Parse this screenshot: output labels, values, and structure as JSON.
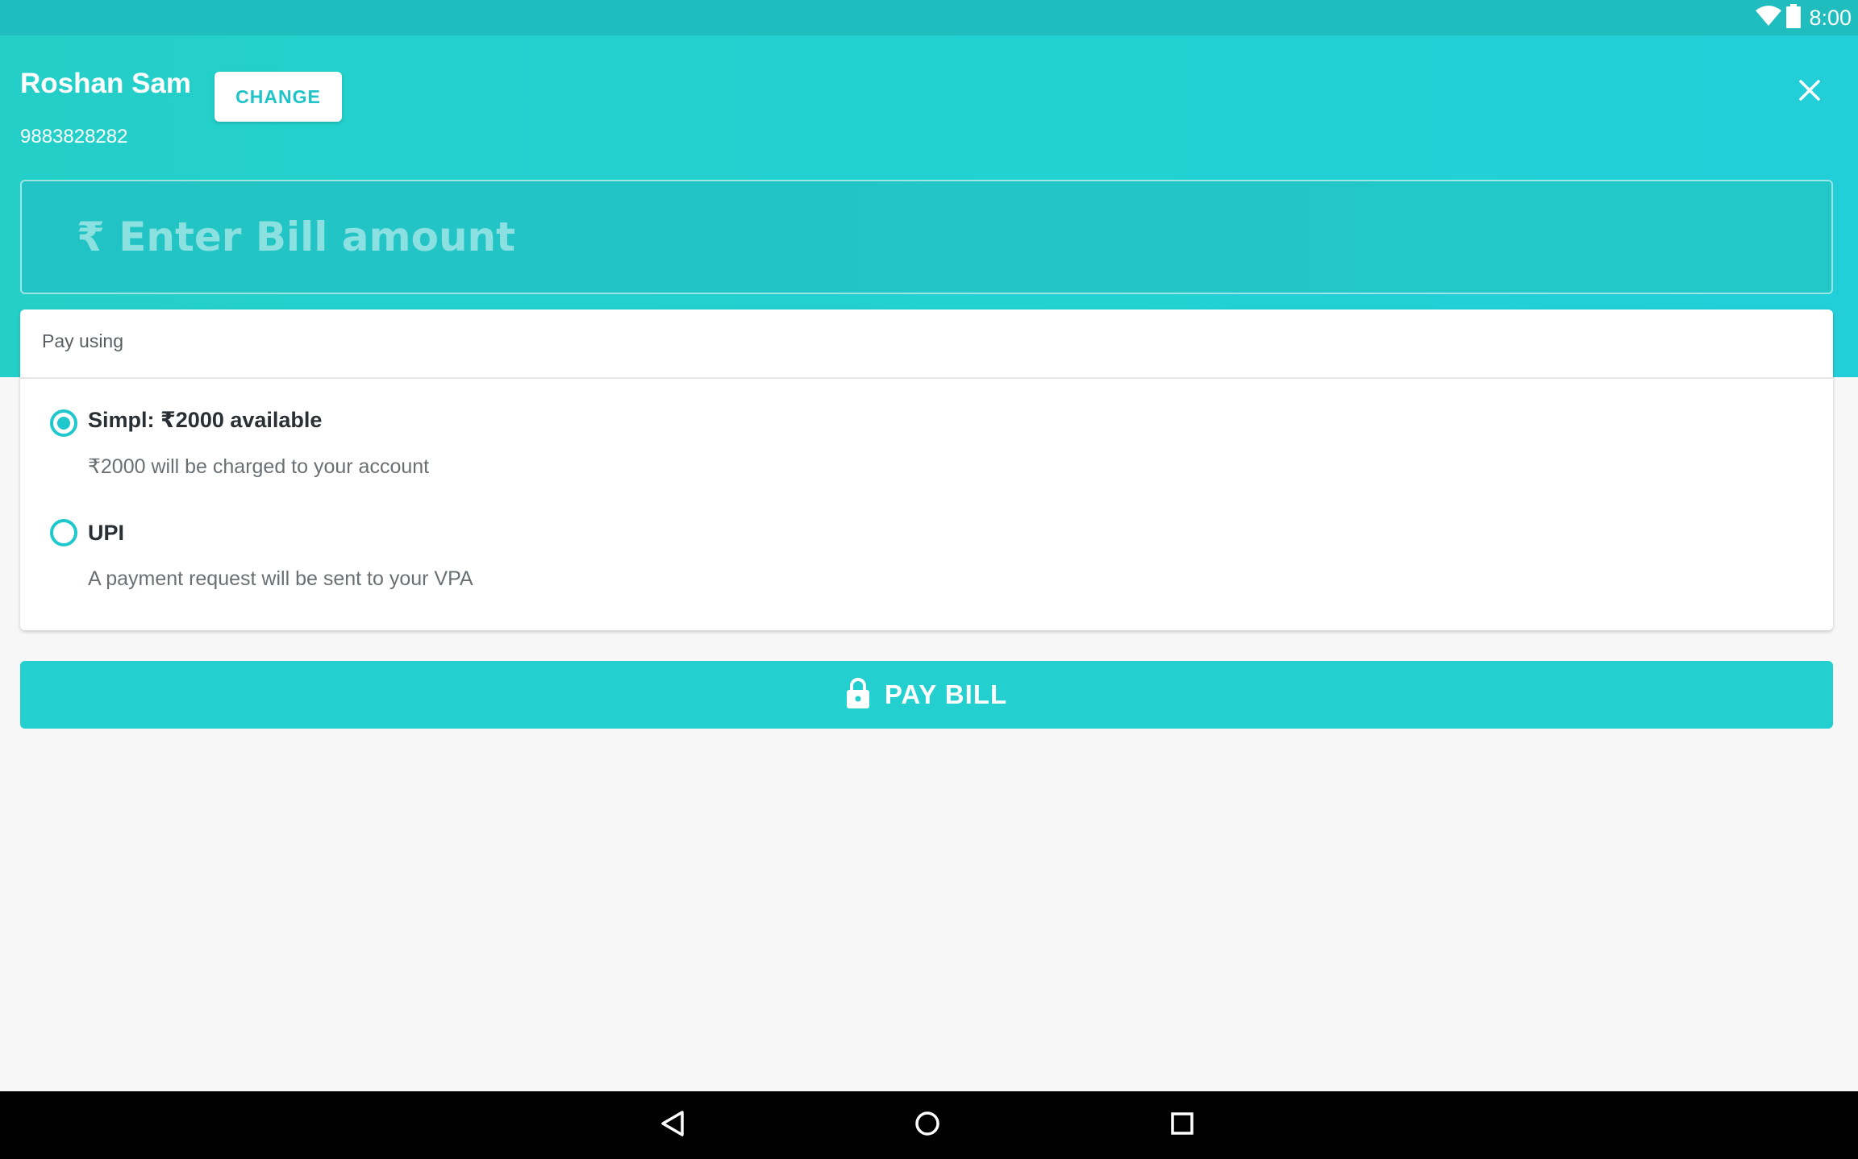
{
  "status_bar": {
    "time": "8:00",
    "wifi_icon": "wifi-icon",
    "battery_icon": "battery-icon"
  },
  "header": {
    "user_name": "Roshan Sam",
    "phone": "9883828282",
    "change_label": "CHANGE",
    "close_icon": "close-icon"
  },
  "amount": {
    "placeholder": "₹ Enter Bill amount",
    "value": ""
  },
  "payment": {
    "section_label": "Pay using",
    "options": [
      {
        "title": "Simpl: ₹2000 available",
        "description": "₹2000 will be charged to your account",
        "selected": true
      },
      {
        "title": "UPI",
        "description": "A payment request will be sent to your VPA",
        "selected": false
      }
    ]
  },
  "pay_button": {
    "label": "PAY BILL",
    "icon": "lock-icon"
  },
  "nav_bar": {
    "back_icon": "back-icon",
    "home_icon": "home-icon",
    "recents_icon": "recents-icon"
  },
  "colors": {
    "accent": "#23d0cf",
    "header_gradient_start": "#24cfc8",
    "header_gradient_end": "#22ced8",
    "status_bar": "#1fbdbd",
    "background": "#f7f7f7"
  }
}
